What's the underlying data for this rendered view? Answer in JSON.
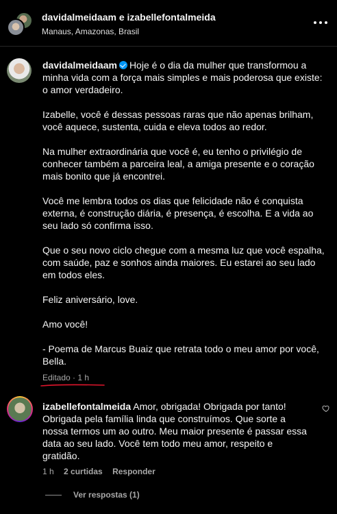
{
  "header": {
    "accounts_text": "davidalmeidaam e izabellefontalmeida",
    "location": "Manaus, Amazonas, Brasil",
    "more_icon": "more-horizontal-icon"
  },
  "post": {
    "username": "davidalmeidaam",
    "verified_icon": "verified-badge-icon",
    "first_line": "Hoje é o dia da mulher que transformou a minha vida com a força mais simples e mais poderosa que existe: o amor verdadeiro.",
    "paragraphs": [
      "Izabelle, você é dessas pessoas raras que não apenas brilham, você aquece, sustenta, cuida e eleva todos ao redor.",
      "Na mulher extraordinária que você é, eu tenho o privilégio de conhecer também a parceira leal, a amiga presente e o coração mais bonito que já encontrei.",
      "Você me lembra todos os dias que felicidade não é conquista externa, é construção diária, é presença, é escolha. E a vida ao seu lado só confirma isso.",
      "Que o seu novo ciclo chegue com a mesma luz que você espalha, com saúde, paz e sonhos ainda maiores. Eu estarei ao seu lado em todos eles.",
      "Feliz aniversário, love.",
      "Amo você!",
      "- Poema de Marcus Buaiz que retrata todo o meu amor por você, Bella."
    ],
    "edited_label": "Editado · 1 h",
    "annotation_color": "#e0152c"
  },
  "comment": {
    "username": "izabellefontalmeida",
    "text": "Amor, obrigada! Obrigada por tanto! Obrigada pela família linda que construímos. Que sorte a nossa termos um ao outro. Meu maior presente é passar essa data ao seu lado. Você tem todo meu amor, respeito e gratidão.",
    "time": "1 h",
    "likes": "2 curtidas",
    "reply_label": "Responder",
    "like_icon": "heart-outline-icon",
    "view_replies": "Ver respostas (1)"
  }
}
